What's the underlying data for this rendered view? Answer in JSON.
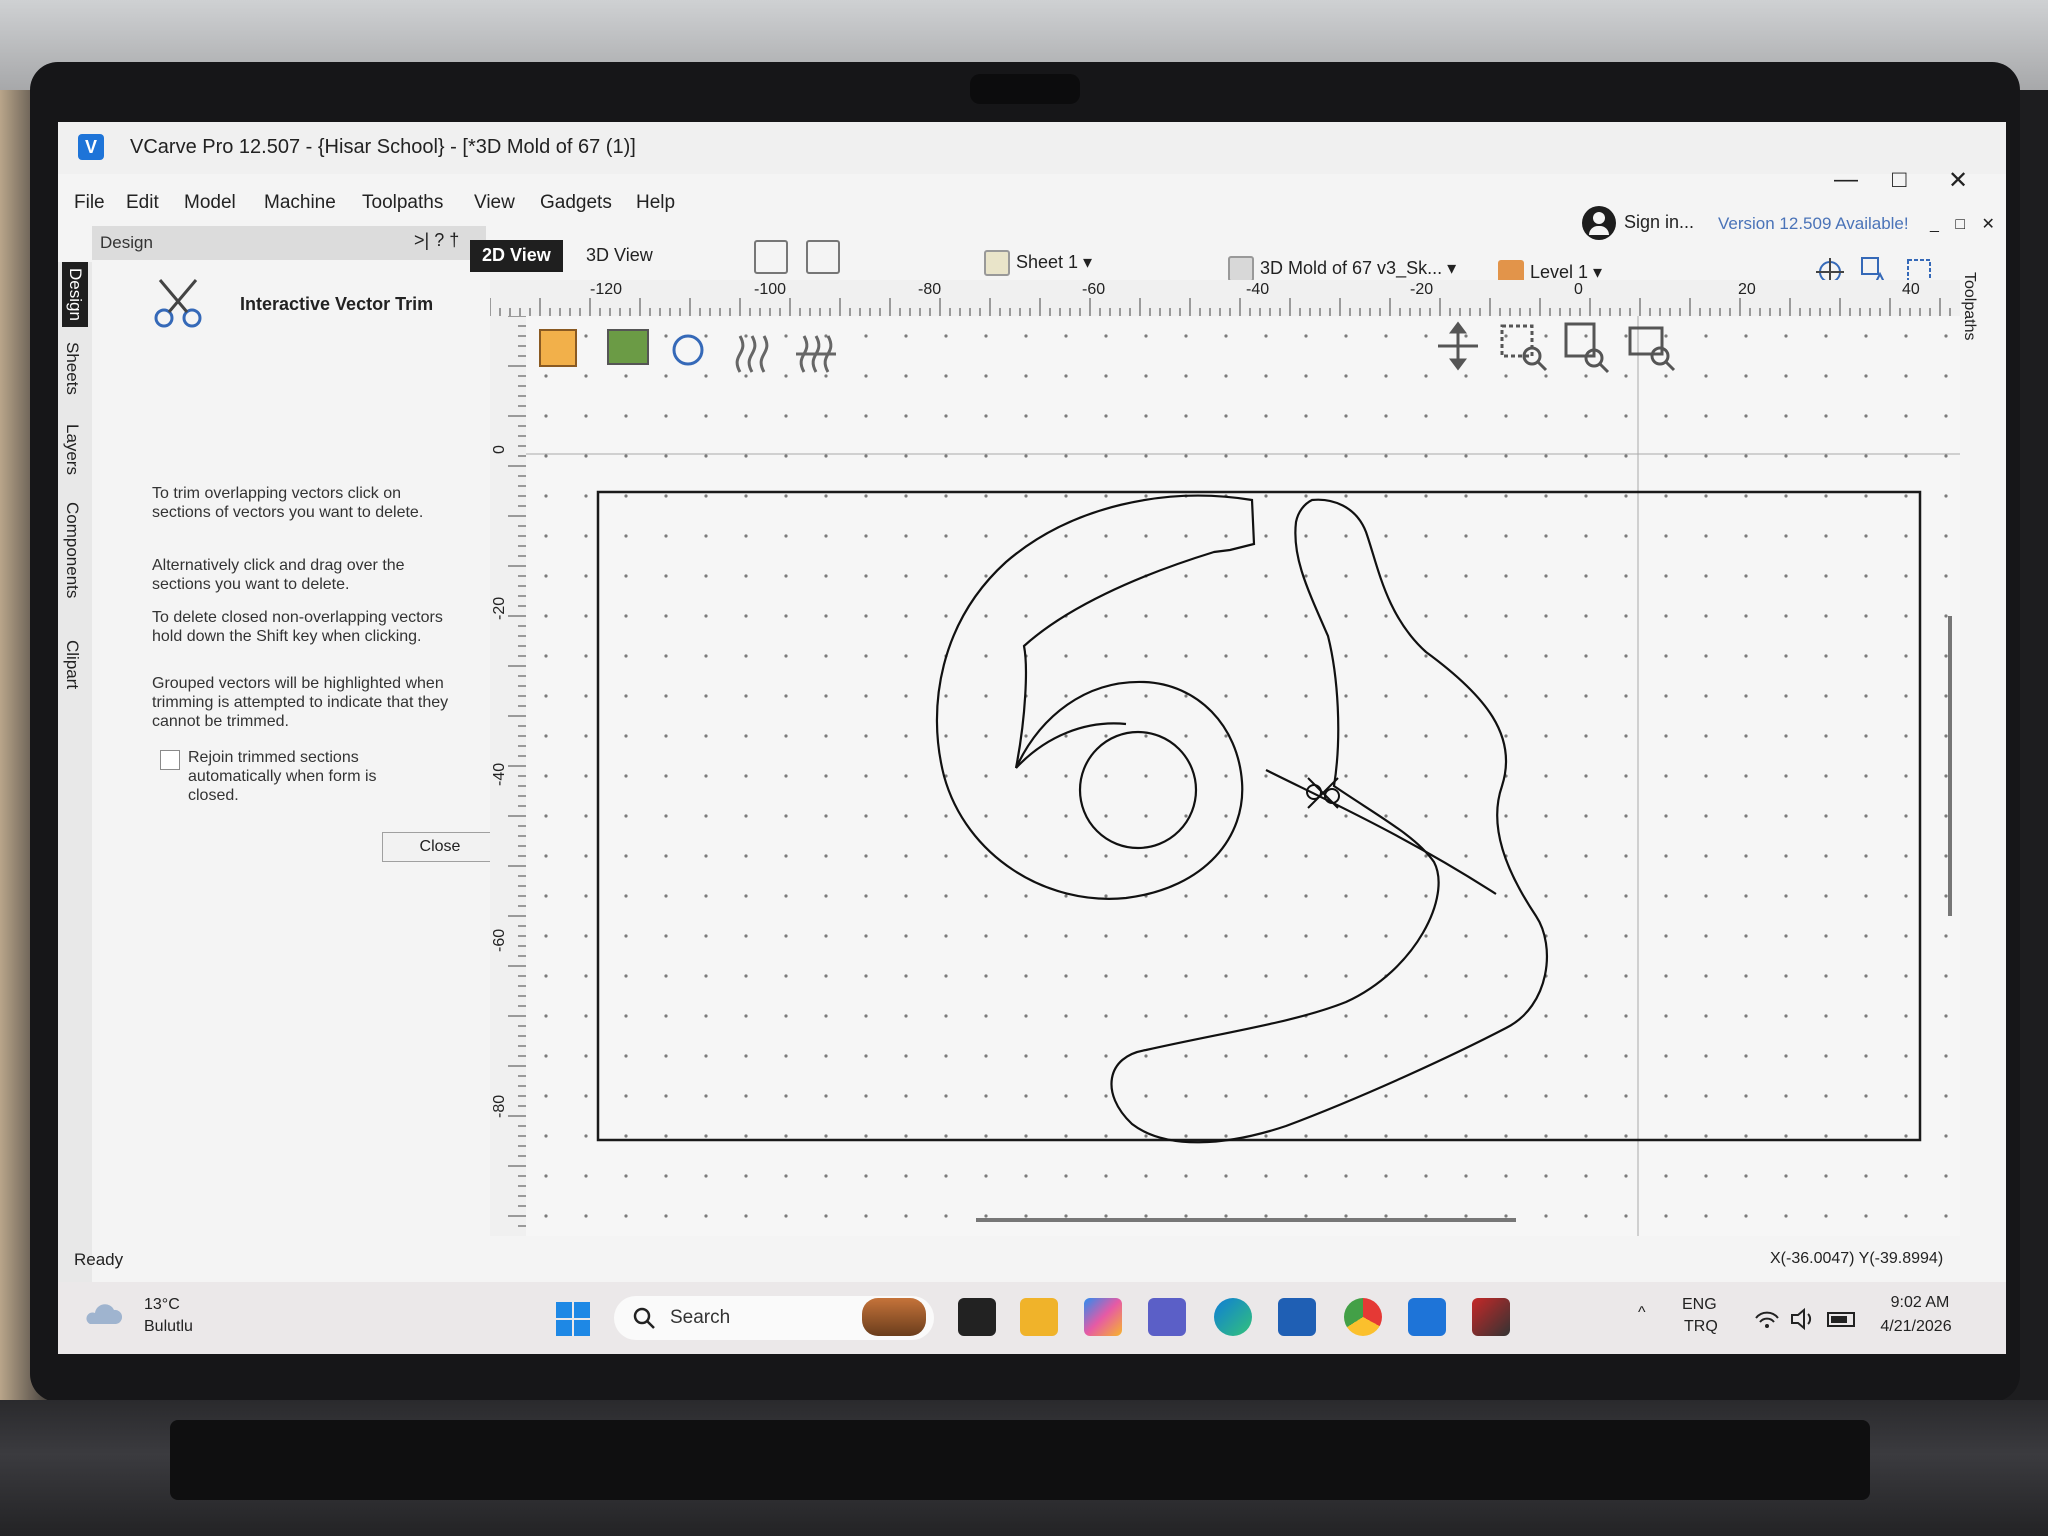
{
  "window": {
    "title": "VCarve Pro 12.507 - {Hisar School} - [*3D Mold of 67 (1)]",
    "logo_letter": "V",
    "controls": {
      "minimize": "—",
      "maximize": "□",
      "close": "✕"
    }
  },
  "menu": {
    "items": [
      "File",
      "Edit",
      "Model",
      "Machine",
      "Toolpaths",
      "View",
      "Gadgets",
      "Help"
    ]
  },
  "account": {
    "signin_label": "Sign in...",
    "version_note": "Version 12.509 Available!",
    "doc_controls": "_ □ ✕"
  },
  "side_tabs": [
    "Design",
    "Sheets",
    "Layers",
    "Components",
    "Clipart"
  ],
  "right_tab": "Toolpaths",
  "panel": {
    "header": "Design",
    "header_icons": ">| ? †",
    "tool_icon": "scissors-icon",
    "tool_title": "Interactive Vector Trim",
    "paragraphs": [
      "To trim overlapping vectors click on sections of vectors you want to delete.",
      "Alternatively click and drag over the sections you want to delete.",
      "To delete closed non-overlapping vectors hold down the Shift key when clicking.",
      "Grouped vectors will be highlighted when trimming is attempted to indicate that they cannot be trimmed."
    ],
    "rejoin_checkbox": {
      "label": "Rejoin trimmed sections automatically when form is closed.",
      "checked": false
    },
    "close_button": "Close"
  },
  "view_tabs": {
    "active": "2D View",
    "inactive": "3D View"
  },
  "toolbar": {
    "sheet": "Sheet 1 ▾",
    "model": "3D Mold of 67 v3_Sk... ▾",
    "level": "Level 1 ▾"
  },
  "ruler": {
    "h_labels": [
      "-120",
      "-100",
      "-80",
      "-60",
      "-40",
      "-20",
      "0",
      "20",
      "40"
    ],
    "v_labels": [
      "0",
      "-20",
      "-40",
      "-60",
      "-80"
    ]
  },
  "status": {
    "ready": "Ready",
    "coords": "X(-36.0047) Y(-39.8994)"
  },
  "taskbar": {
    "weather_temp": "13°C",
    "weather_desc": "Bulutlu",
    "search_label": "Search",
    "lang_top": "ENG",
    "lang_bottom": "TRQ",
    "time": "9:02 AM",
    "date": "4/21/2026",
    "apps": [
      "widgets-icon",
      "task-view-icon",
      "file-explorer-icon",
      "copilot-icon",
      "teams-icon",
      "edge-icon",
      "store-icon",
      "chrome-icon",
      "vcarve-icon",
      "app-icon"
    ]
  },
  "colors": {
    "accent": "#1e74d8",
    "active_tab": "#1f1f1f",
    "version_note": "#4a73b8"
  }
}
